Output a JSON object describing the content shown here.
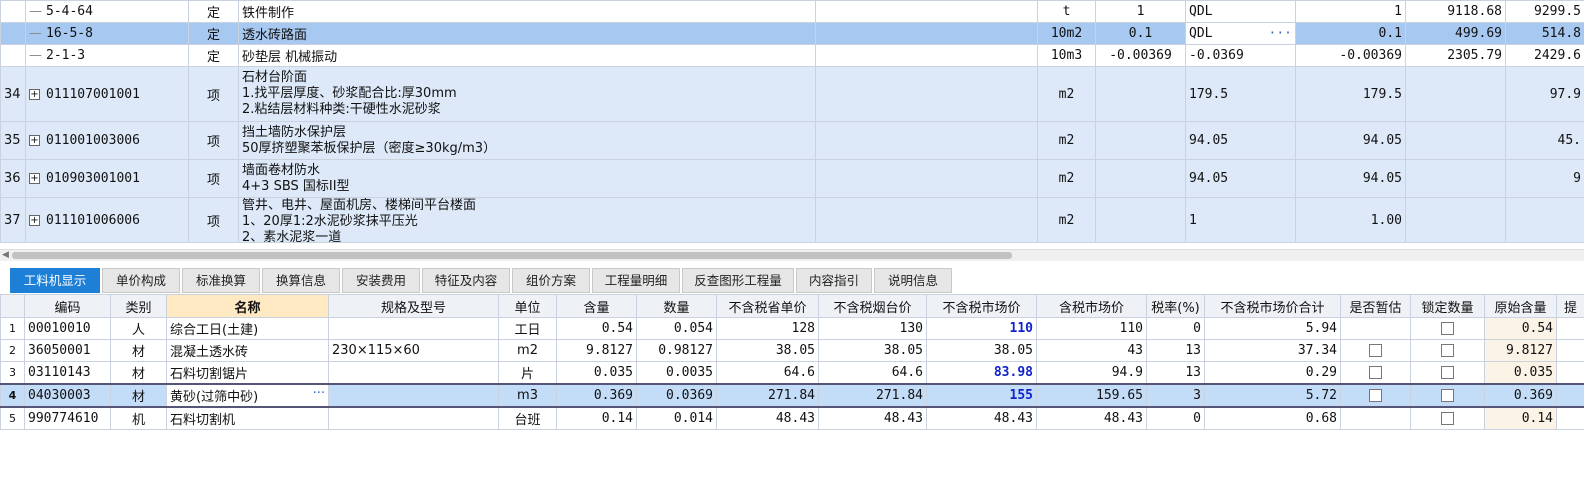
{
  "top_rows": [
    {
      "num": "",
      "code": "5-4-64",
      "type": "定",
      "name": "铁件制作",
      "unit": "t",
      "qty_expr": "1",
      "qty_code": "QDL",
      "qty": "1",
      "price": "9118.68",
      "total": "9299.5"
    },
    {
      "num": "",
      "code": "16-5-8",
      "type": "定",
      "name": "透水砖路面",
      "unit": "10m2",
      "qty_expr": "0.1",
      "qty_code": "QDL",
      "qty": "0.1",
      "price": "499.69",
      "total": "514.8"
    },
    {
      "num": "",
      "code": "2-1-3",
      "type": "定",
      "name": "砂垫层 机械振动",
      "unit": "10m3",
      "qty_expr": "-0.00369",
      "qty_code": "-0.0369",
      "qty": "-0.00369",
      "price": "2305.79",
      "total": "2429.6"
    },
    {
      "num": "34",
      "code": "011107001001",
      "type": "项",
      "name_lines": [
        "石材台阶面",
        "1.找平层厚度、砂浆配合比:厚30mm",
        "2.粘结层材料种类:干硬性水泥砂浆"
      ],
      "unit": "m2",
      "qty_code": "179.5",
      "qty": "179.5",
      "total": "97.9"
    },
    {
      "num": "35",
      "code": "011001003006",
      "type": "项",
      "name_lines": [
        "挡土墙防水保护层",
        "50厚挤塑聚苯板保护层（密度≥30kg/m3）"
      ],
      "unit": "m2",
      "qty_code": "94.05",
      "qty": "94.05",
      "total": "45."
    },
    {
      "num": "36",
      "code": "010903001001",
      "type": "项",
      "name_lines": [
        "墙面卷材防水",
        "4+3 SBS 国标II型"
      ],
      "unit": "m2",
      "qty_code": "94.05",
      "qty": "94.05",
      "total": "9"
    },
    {
      "num": "37",
      "code": "011101006006",
      "type": "项",
      "name_lines": [
        "管井、电井、屋面机房、楼梯间平台楼面",
        "1、20厚1:2水泥砂浆抹平压光",
        "2、素水泥浆一道"
      ],
      "unit": "m2",
      "qty_code": "1",
      "qty": "1.00",
      "total": ""
    }
  ],
  "tabs": [
    "工料机显示",
    "单价构成",
    "标准换算",
    "换算信息",
    "安装费用",
    "特征及内容",
    "组价方案",
    "工程量明细",
    "反查图形工程量",
    "内容指引",
    "说明信息"
  ],
  "bottom_headers": [
    "编码",
    "类别",
    "名称",
    "规格及型号",
    "单位",
    "含量",
    "数量",
    "不含税省单价",
    "不含税烟台价",
    "不含税市场价",
    "含税市场价",
    "税率(%)",
    "不含税市场价合计",
    "是否暂估",
    "锁定数量",
    "原始含量"
  ],
  "bottom_rows": [
    {
      "idx": "1",
      "code": "00010010",
      "cat": "人",
      "name": "综合工日(土建)",
      "spec": "",
      "unit": "工日",
      "content": "0.54",
      "qty": "0.054",
      "prov": "128",
      "yt": "130",
      "market": "110",
      "market_tax": "110",
      "rate": "0",
      "total": "5.94",
      "est": false,
      "lock": true,
      "orig": "0.54"
    },
    {
      "idx": "2",
      "code": "36050001",
      "cat": "材",
      "name": "混凝土透水砖",
      "spec": "230×115×60",
      "unit": "m2",
      "content": "9.8127",
      "qty": "0.98127",
      "prov": "38.05",
      "yt": "38.05",
      "market": "38.05",
      "market_tax": "43",
      "rate": "13",
      "total": "37.34",
      "est": true,
      "lock": true,
      "orig": "9.8127"
    },
    {
      "idx": "3",
      "code": "03110143",
      "cat": "材",
      "name": "石料切割锯片",
      "spec": "",
      "unit": "片",
      "content": "0.035",
      "qty": "0.0035",
      "prov": "64.6",
      "yt": "64.6",
      "market": "83.98",
      "market_tax": "94.9",
      "rate": "13",
      "total": "0.29",
      "est": true,
      "lock": true,
      "orig": "0.035"
    },
    {
      "idx": "4",
      "code": "04030003",
      "cat": "材",
      "name": "黄砂(过筛中砂)",
      "spec": "",
      "unit": "m3",
      "content": "0.369",
      "qty": "0.0369",
      "prov": "271.84",
      "yt": "271.84",
      "market": "155",
      "market_tax": "159.65",
      "rate": "3",
      "total": "5.72",
      "est": true,
      "lock": true,
      "orig": "0.369"
    },
    {
      "idx": "5",
      "code": "990774610",
      "cat": "机",
      "name": "石料切割机",
      "spec": "",
      "unit": "台班",
      "content": "0.14",
      "qty": "0.014",
      "prov": "48.43",
      "yt": "48.43",
      "market": "48.43",
      "market_tax": "48.43",
      "rate": "0",
      "total": "0.68",
      "est": false,
      "lock": true,
      "orig": "0.14"
    }
  ],
  "bottom_partial_header": "提",
  "colors": {
    "selected_row": "#a7c8f0",
    "row_blue": "#dde9f8",
    "tab_active": "#1d7fd6",
    "highlight_value": "#1122cc"
  }
}
